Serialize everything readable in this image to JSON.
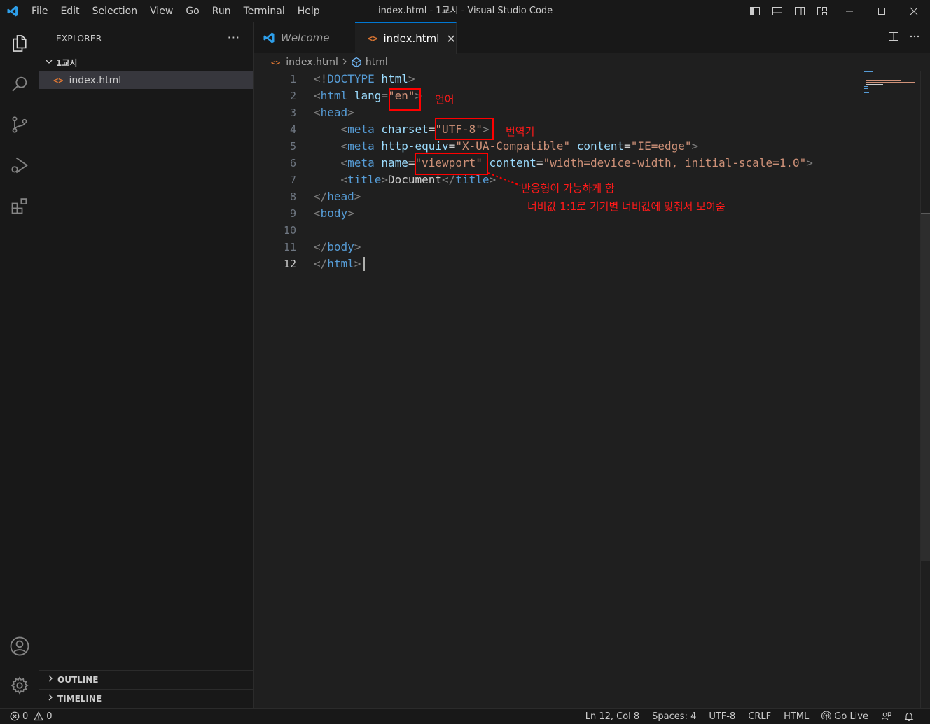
{
  "window": {
    "title": "index.html - 1교시 - Visual Studio Code",
    "menu": [
      "File",
      "Edit",
      "Selection",
      "View",
      "Go",
      "Run",
      "Terminal",
      "Help"
    ]
  },
  "activity_bar": {
    "items": [
      "files-icon",
      "search-icon",
      "source-control-icon",
      "run-debug-icon",
      "extensions-icon"
    ],
    "bottom_items": [
      "account-icon",
      "manage-gear-icon"
    ]
  },
  "sidebar": {
    "title": "EXPLORER",
    "more": "···",
    "folder": "1교시",
    "files": [
      {
        "name": "index.html",
        "selected": true
      }
    ],
    "panels": [
      "OUTLINE",
      "TIMELINE"
    ]
  },
  "tabs": [
    {
      "label": "Welcome",
      "active": false,
      "italic": true
    },
    {
      "label": "index.html",
      "active": true,
      "close": "✕"
    }
  ],
  "editor_actions": [
    "split-editor-icon",
    "more-actions-icon"
  ],
  "breadcrumb": {
    "file": "index.html",
    "symbol": "html"
  },
  "editor": {
    "line_numbers": [
      "1",
      "2",
      "3",
      "4",
      "5",
      "6",
      "7",
      "8",
      "9",
      "10",
      "11",
      "12"
    ],
    "active_line": 12,
    "lines": {
      "l1": {
        "p1": "<!",
        "tag": "DOCTYPE",
        "sp": " ",
        "attr": "html",
        "p2": ">"
      },
      "l2": {
        "p1": "<",
        "tag": "html",
        "sp": " ",
        "attr": "lang",
        "eq": "=",
        "val": "\"en\"",
        "p2": ">"
      },
      "l3": {
        "p1": "<",
        "tag": "head",
        "p2": ">"
      },
      "l4": {
        "indent": "    ",
        "p1": "<",
        "tag": "meta",
        "sp": " ",
        "attr": "charset",
        "eq": "=",
        "val": "\"UTF-8\"",
        "p2": ">"
      },
      "l5": {
        "indent": "    ",
        "p1": "<",
        "tag": "meta",
        "sp": " ",
        "attr": "http-equiv",
        "eq": "=",
        "val": "\"X-UA-Compatible\"",
        "sp2": " ",
        "attr2": "content",
        "eq2": "=",
        "val2": "\"IE=edge\"",
        "p2": ">"
      },
      "l6": {
        "indent": "    ",
        "p1": "<",
        "tag": "meta",
        "sp": " ",
        "attr": "name",
        "eq": "=",
        "val": "\"viewport\"",
        "sp2": " ",
        "attr2": "content",
        "eq2": "=",
        "val2": "\"width=device-width, initial-scale=1.0\"",
        "p2": ">"
      },
      "l7": {
        "indent": "    ",
        "p1": "<",
        "tag": "title",
        "p2": ">",
        "text": "Document",
        "p3": "</",
        "tag2": "title",
        "p4": ">"
      },
      "l8": {
        "p1": "</",
        "tag": "head",
        "p2": ">"
      },
      "l9": {
        "p1": "<",
        "tag": "body",
        "p2": ">"
      },
      "l11": {
        "p1": "</",
        "tag": "body",
        "p2": ">"
      },
      "l12": {
        "p1": "</",
        "tag": "html",
        "p2": ">"
      }
    }
  },
  "annotations": {
    "lang": "언어",
    "charset": "번역기",
    "viewport_1": "반응형이 가능하게 함",
    "viewport_2": "너비값 1:1로 기기별 너비값에 맞춰서 보여줌",
    "color": "#ff0000"
  },
  "status_bar": {
    "errors": "0",
    "warnings": "0",
    "position": "Ln 12, Col 8",
    "spaces": "Spaces: 4",
    "encoding": "UTF-8",
    "eol": "CRLF",
    "language": "HTML",
    "go_live": "Go Live"
  },
  "colors": {
    "accent": "#0078d4",
    "tag": "#569cd6",
    "attribute": "#9cdcfe",
    "string": "#ce9178",
    "html_icon": "#e37933"
  }
}
